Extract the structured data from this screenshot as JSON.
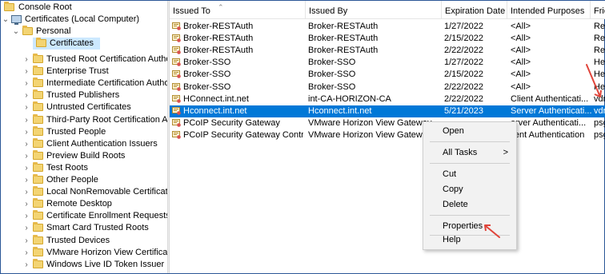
{
  "tree": {
    "root_label": "Console Root",
    "computer_label": "Certificates (Local Computer)",
    "personal_label": "Personal",
    "certificates_label": "Certificates",
    "stores": [
      "Trusted Root Certification Author",
      "Enterprise Trust",
      "Intermediate Certification Author",
      "Trusted Publishers",
      "Untrusted Certificates",
      "Third-Party Root Certification Aut",
      "Trusted People",
      "Client Authentication Issuers",
      "Preview Build Roots",
      "Test Roots",
      "Other People",
      "Local NonRemovable Certificates",
      "Remote Desktop",
      "Certificate Enrollment Requests",
      "Smart Card Trusted Roots",
      "Trusted Devices",
      "VMware Horizon View Certificates",
      "Windows Live ID Token Issuer"
    ]
  },
  "columns": [
    "Issued To",
    "Issued By",
    "Expiration Date",
    "Intended Purposes",
    "Frie"
  ],
  "rows": [
    [
      "Broker-RESTAuth",
      "Broker-RESTAuth",
      "1/27/2022",
      "<All>",
      "Res"
    ],
    [
      "Broker-RESTAuth",
      "Broker-RESTAuth",
      "2/15/2022",
      "<All>",
      "Res"
    ],
    [
      "Broker-RESTAuth",
      "Broker-RESTAuth",
      "2/22/2022",
      "<All>",
      "Res"
    ],
    [
      "Broker-SSO",
      "Broker-SSO",
      "1/27/2022",
      "<All>",
      "Hel"
    ],
    [
      "Broker-SSO",
      "Broker-SSO",
      "2/15/2022",
      "<All>",
      "Hel"
    ],
    [
      "Broker-SSO",
      "Broker-SSO",
      "2/22/2022",
      "<All>",
      "Hel"
    ],
    [
      "HConnect.int.net",
      "int-CA-HORIZON-CA",
      "2/22/2022",
      "Client Authenticati...",
      "vdr"
    ],
    [
      "Hconnect.int.net",
      "Hconnect.int.net",
      "5/21/2023",
      "Server Authenticati...",
      "vdr"
    ],
    [
      "PCoIP Security Gateway",
      "VMware Horizon View Gateway",
      "",
      "erver Authenticati...",
      "psg"
    ],
    [
      "PCoIP Security Gateway Contro...",
      "VMware Horizon View Gateway",
      "",
      "lient Authentication",
      "psg"
    ]
  ],
  "selected_row_index": 7,
  "context_menu": {
    "open": "Open",
    "all_tasks": "All Tasks",
    "submenu_arrow": ">",
    "cut": "Cut",
    "copy": "Copy",
    "delete": "Delete",
    "properties": "Properties",
    "help": "Help"
  },
  "colors": {
    "selection": "#0078d7",
    "tree_selection": "#cce8ff",
    "annotation_arrow": "#e0443a",
    "frame_border": "#2b5797"
  },
  "icons": {
    "folder": "folder-icon",
    "computer": "computer-icon",
    "certificate": "certificate-icon",
    "expand": "chevron-right-icon",
    "collapse": "chevron-down-icon"
  }
}
